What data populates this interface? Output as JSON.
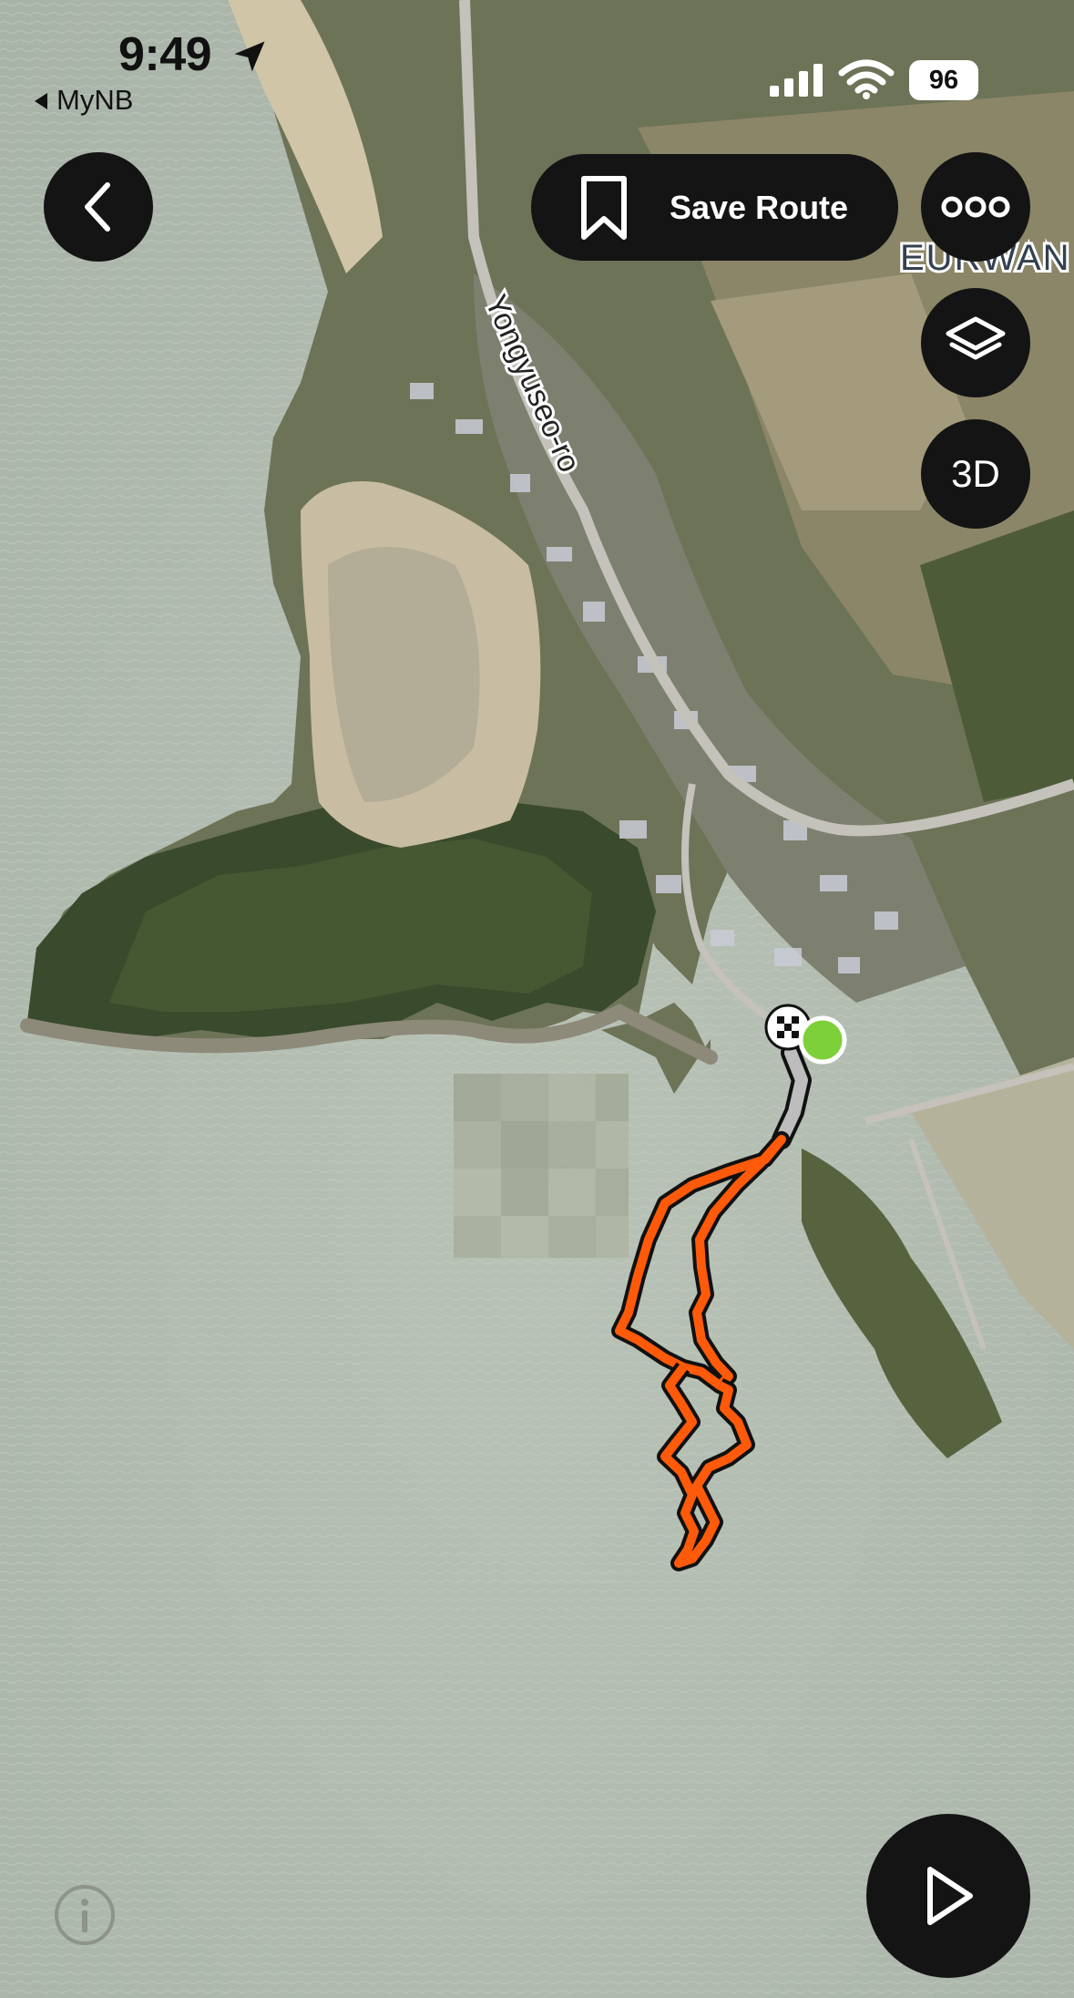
{
  "status_bar": {
    "time": "9:49",
    "back_app": "MyNB",
    "battery": "96",
    "location_icon": "location-arrow-icon",
    "signal_icon": "cellular-signal-icon",
    "wifi_icon": "wifi-icon"
  },
  "toolbar": {
    "back_icon": "chevron-left-icon",
    "save_label": "Save Route",
    "save_icon": "bookmark-icon",
    "more_icon": "more-dots-icon",
    "layers_icon": "layers-icon",
    "three_d_label": "3D"
  },
  "map": {
    "road_label": "Yongyuseo-ro",
    "place_label": "EURWAN",
    "route_color": "#ff5a0a",
    "start_marker_color": "#7ed03a",
    "finish_marker": "checkered-flag-icon"
  },
  "controls": {
    "play_icon": "play-icon",
    "info_icon": "info-icon"
  }
}
